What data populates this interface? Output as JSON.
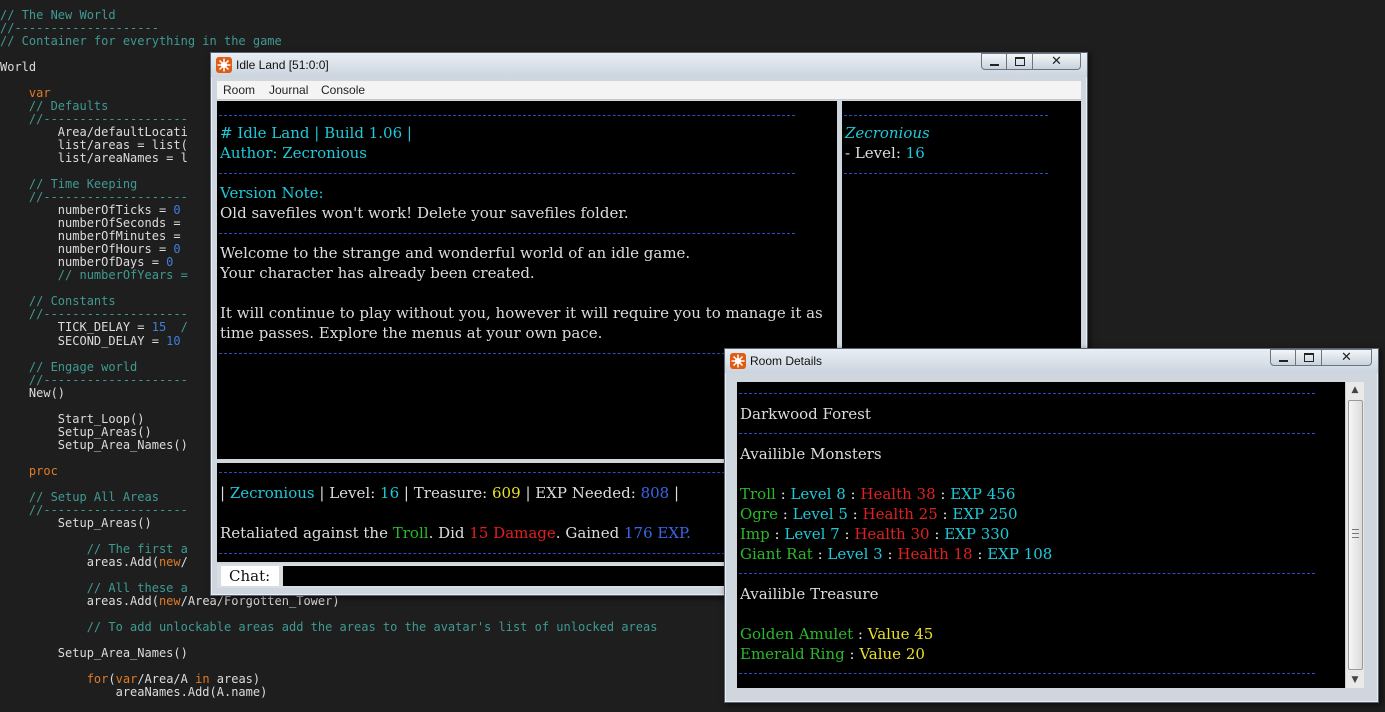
{
  "editor": {
    "lines": [
      [
        {
          "t": "// The New World",
          "c": "cm"
        }
      ],
      [
        {
          "t": "//--------------------",
          "c": "cm"
        }
      ],
      [
        {
          "t": "// Container for everything in the game",
          "c": "cm"
        }
      ],
      [],
      [
        {
          "t": "World",
          "c": "tx"
        }
      ],
      [],
      [
        {
          "t": "    ",
          "c": "tx"
        },
        {
          "t": "var",
          "c": "kw"
        }
      ],
      [
        {
          "t": "    // Defaults",
          "c": "cm"
        }
      ],
      [
        {
          "t": "    //--------------------",
          "c": "cm"
        }
      ],
      [
        {
          "t": "        Area/defaultLocati",
          "c": "tx"
        }
      ],
      [
        {
          "t": "        list/areas = list(",
          "c": "tx"
        }
      ],
      [
        {
          "t": "        list/areaNames = l",
          "c": "tx"
        }
      ],
      [],
      [
        {
          "t": "    // Time Keeping",
          "c": "cm"
        }
      ],
      [
        {
          "t": "    //--------------------",
          "c": "cm"
        }
      ],
      [
        {
          "t": "        numberOfTicks = ",
          "c": "tx"
        },
        {
          "t": "0",
          "c": "nm"
        }
      ],
      [
        {
          "t": "        numberOfSeconds = ",
          "c": "tx"
        }
      ],
      [
        {
          "t": "        numberOfMinutes = ",
          "c": "tx"
        }
      ],
      [
        {
          "t": "        numberOfHours = ",
          "c": "tx"
        },
        {
          "t": "0",
          "c": "nm"
        }
      ],
      [
        {
          "t": "        numberOfDays = ",
          "c": "tx"
        },
        {
          "t": "0",
          "c": "nm"
        }
      ],
      [
        {
          "t": "        // numberOfYears =",
          "c": "cm"
        }
      ],
      [],
      [
        {
          "t": "    // Constants",
          "c": "cm"
        }
      ],
      [
        {
          "t": "    //--------------------",
          "c": "cm"
        }
      ],
      [
        {
          "t": "        TICK_DELAY = ",
          "c": "tx"
        },
        {
          "t": "15",
          "c": "nm"
        },
        {
          "t": "  /",
          "c": "cm"
        }
      ],
      [
        {
          "t": "        SECOND_DELAY = ",
          "c": "tx"
        },
        {
          "t": "10",
          "c": "nm"
        }
      ],
      [],
      [
        {
          "t": "    // Engage world",
          "c": "cm"
        }
      ],
      [
        {
          "t": "    //--------------------",
          "c": "cm"
        }
      ],
      [
        {
          "t": "    New()",
          "c": "tx"
        }
      ],
      [],
      [
        {
          "t": "        Start_Loop()",
          "c": "tx"
        }
      ],
      [
        {
          "t": "        Setup_Areas()",
          "c": "tx"
        }
      ],
      [
        {
          "t": "        Setup_Area_Names()",
          "c": "tx"
        }
      ],
      [],
      [
        {
          "t": "    ",
          "c": "tx"
        },
        {
          "t": "proc",
          "c": "kw"
        }
      ],
      [],
      [
        {
          "t": "    // Setup All Areas",
          "c": "cm"
        }
      ],
      [
        {
          "t": "    //--------------------",
          "c": "cm"
        }
      ],
      [
        {
          "t": "        Setup_Areas()",
          "c": "tx"
        }
      ],
      [],
      [
        {
          "t": "            // The first a",
          "c": "cm"
        }
      ],
      [
        {
          "t": "            areas.Add(",
          "c": "tx"
        },
        {
          "t": "new",
          "c": "kw"
        },
        {
          "t": "/",
          "c": "tx"
        }
      ],
      [],
      [
        {
          "t": "            // All these a",
          "c": "cm"
        }
      ],
      [
        {
          "t": "            areas.Add(",
          "c": "tx"
        },
        {
          "t": "new",
          "c": "kw"
        },
        {
          "t": "/Area/Forgotten_Tower)",
          "c": "tx"
        }
      ],
      [],
      [
        {
          "t": "            // To add unlockable areas add the areas to the avatar's list of unlocked areas",
          "c": "cm"
        }
      ],
      [],
      [
        {
          "t": "        Setup_Area_Names()",
          "c": "tx"
        }
      ],
      [],
      [
        {
          "t": "            ",
          "c": "tx"
        },
        {
          "t": "for",
          "c": "kw"
        },
        {
          "t": "(",
          "c": "tx"
        },
        {
          "t": "var",
          "c": "kw"
        },
        {
          "t": "/Area/A ",
          "c": "tx"
        },
        {
          "t": "in",
          "c": "kw"
        },
        {
          "t": " areas)",
          "c": "tx"
        }
      ],
      [
        {
          "t": "                areaNames.Add(A.name)",
          "c": "tx"
        }
      ]
    ]
  },
  "main_window": {
    "title": "Idle Land [51:0:0]",
    "menu": [
      "Room",
      "Journal",
      "Console"
    ],
    "info": {
      "build_line": "# Idle Land | Build 1.06 |",
      "author_line": "Author: Zecronious",
      "version_note_label": "Version Note:",
      "version_note": "Old savefiles won't work! Delete your savefiles folder.",
      "welcome_1": "Welcome to the strange and wonderful world of an idle game.",
      "welcome_2": "Your character has already been created.",
      "continue_1": "It will continue to play without you, however it will require you to manage it as",
      "continue_2": "time passes. Explore the menus at your own pace."
    },
    "character": {
      "name": "Zecronious",
      "level_label": "- Level:",
      "level": "16"
    },
    "status": {
      "sep": "|",
      "name": "Zecronious",
      "level_label": "Level:",
      "level": "16",
      "treasure_label": "Treasure:",
      "treasure": "609",
      "exp_label": "EXP Needed:",
      "exp": "808"
    },
    "combat_log": {
      "prefix": "Retaliated against the",
      "target": "Troll",
      "did": ". Did",
      "damage": "15 Damage",
      "gained": ". Gained",
      "exp": "176 EXP."
    },
    "chat_label": "Chat:",
    "chat_value": ""
  },
  "room_window": {
    "title": "Room Details",
    "area": "Darkwood Forest",
    "monsters_heading": "Availible Monsters",
    "monsters": [
      {
        "name": "Troll",
        "level": "Level 8",
        "health": "Health 38",
        "exp": "EXP 456"
      },
      {
        "name": "Ogre",
        "level": "Level 5",
        "health": "Health 25",
        "exp": "EXP 250"
      },
      {
        "name": "Imp",
        "level": "Level 7",
        "health": "Health 30",
        "exp": "EXP 330"
      },
      {
        "name": "Giant Rat",
        "level": "Level 3",
        "health": "Health 18",
        "exp": "EXP 108"
      }
    ],
    "treasure_heading": "Availible Treasure",
    "treasure": [
      {
        "name": "Golden Amulet",
        "value": "Value 45"
      },
      {
        "name": "Emerald Ring",
        "value": "Value 20"
      }
    ],
    "separator": ":"
  },
  "colors": {
    "cyan": "#1ec9d8",
    "green": "#2bb82b",
    "red": "#e02020",
    "yellow": "#e9e02a",
    "blue": "#3a66e6",
    "dash": "#2b4dbf"
  },
  "icons": [
    "app-icon",
    "minimize-icon",
    "maximize-icon",
    "close-icon",
    "scroll-up-icon",
    "scroll-down-icon"
  ]
}
